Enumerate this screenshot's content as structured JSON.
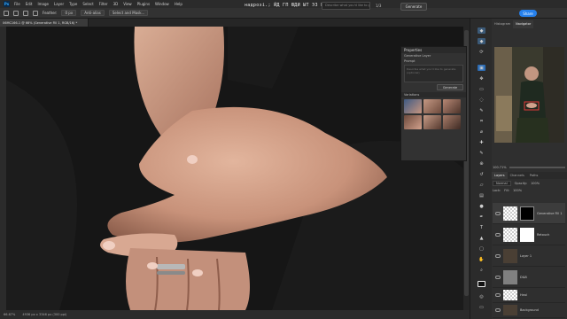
{
  "app": {
    "logo": "Ps"
  },
  "menu": [
    "File",
    "Edit",
    "Image",
    "Layer",
    "Type",
    "Select",
    "Filter",
    "3D",
    "View",
    "Plugins",
    "Window",
    "Help"
  ],
  "options_bar": {
    "feather_label": "Feather:",
    "feather_value": "0 px",
    "antialias": "Anti-alias",
    "select_and_mask": "Select and Mask..."
  },
  "title_overlay": "надрозі.; ЙД ГП ЮДИ ЫТ ЭЗ ЬК ЬАТ ЙД",
  "top_prompt_placeholder": "Describe what you'd like to generate",
  "pager": "1/3",
  "generate_label": "Generate",
  "share_label": "Share",
  "document_tab": "06MC166-1 @ 66% (Generative Fill 1, RGB/16) *",
  "status_bar": {
    "zoom": "66.67%",
    "info": "4936 px x 3346 px (300 ppi)"
  },
  "properties": {
    "title": "Properties",
    "layer_type": "Generative Layer",
    "prompt_label": "Prompt",
    "prompt_placeholder": "Describe what you'd like to generate (optional)",
    "generate_label": "Generate",
    "variations_label": "Variations"
  },
  "right_panel": {
    "tabs": [
      "Histogram",
      "Navigator"
    ],
    "zoom": "100.71%",
    "layer_tabs": [
      "Layers",
      "Channels",
      "Paths"
    ],
    "blend_mode": "Normal",
    "opacity_label": "Opacity:",
    "opacity": "100%",
    "lock_label": "Lock:",
    "fill_label": "Fill:",
    "fill": "100%",
    "layers": [
      {
        "name": "Generative Fill 1",
        "selected": true
      },
      {
        "name": "Retouch",
        "selected": false
      },
      {
        "name": "Layer 1",
        "selected": false
      },
      {
        "name": "D&B",
        "selected": false
      },
      {
        "name": "Heal",
        "selected": false
      },
      {
        "name": "Background",
        "selected": false
      }
    ]
  },
  "colors": {
    "accent": "#2680eb",
    "panel": "#323232",
    "bg": "#1e1e1e"
  }
}
